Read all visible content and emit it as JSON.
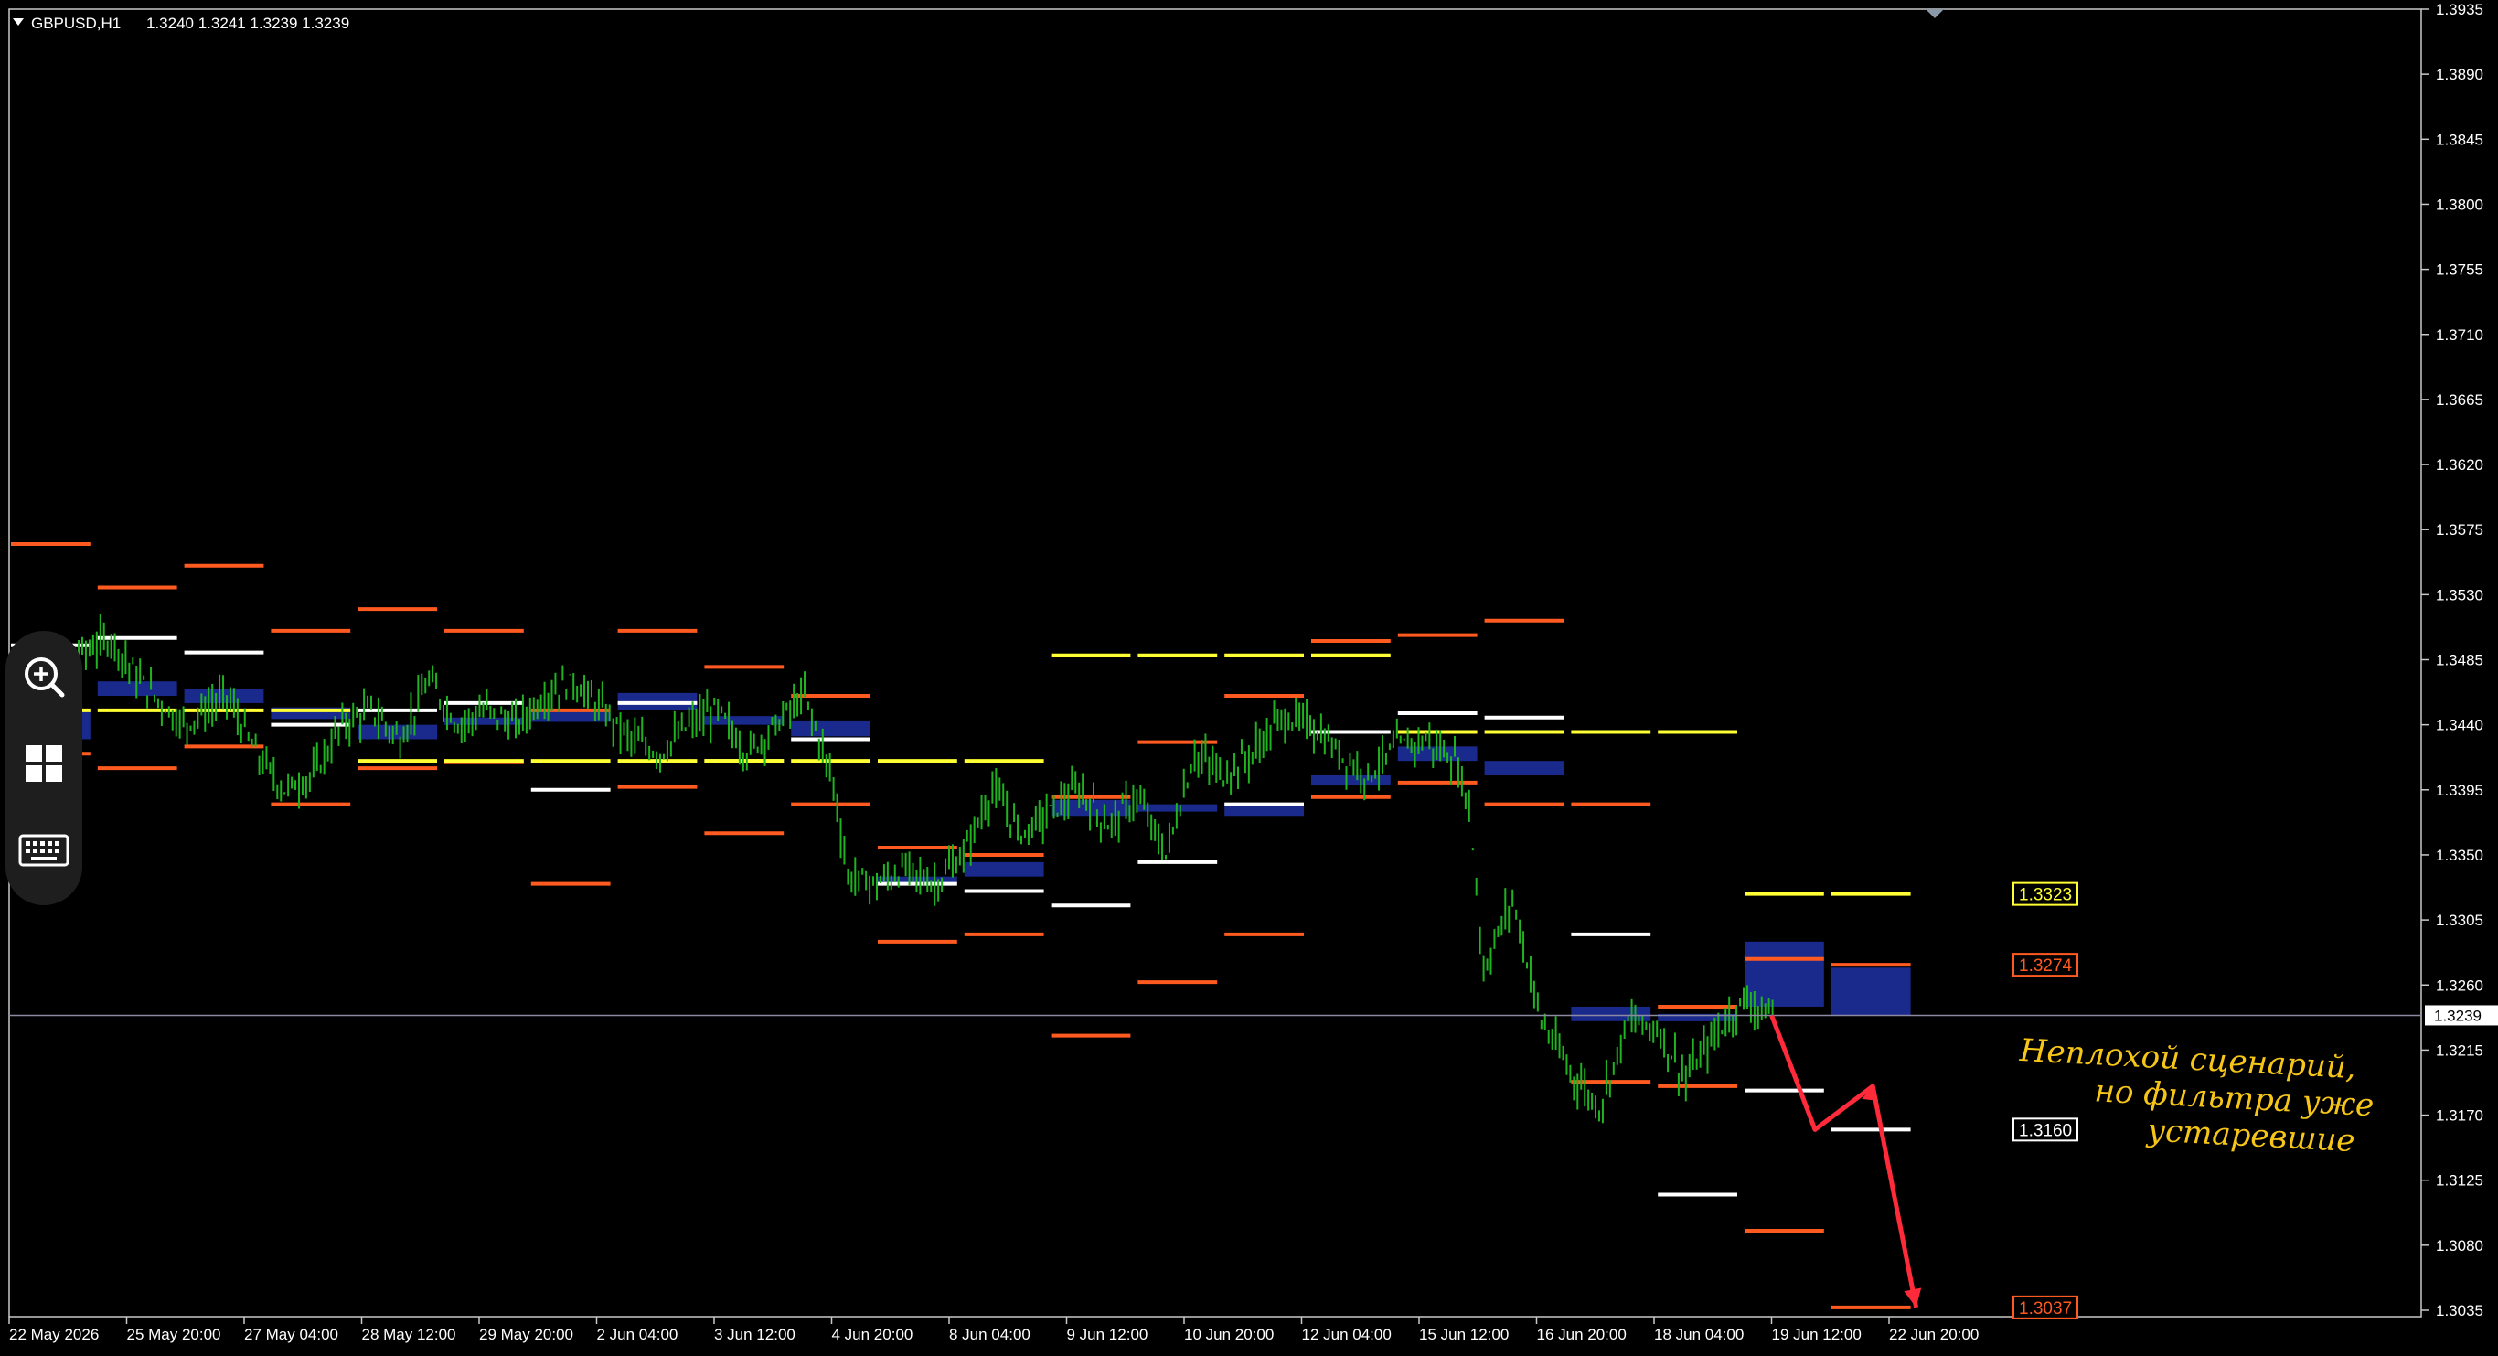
{
  "header": {
    "symbol": "GBPUSD,H1",
    "ohlc": "1.3240 1.3241 1.3239 1.3239"
  },
  "toolbar": {
    "tools": [
      "zoom-in-icon",
      "windows-grid-icon",
      "keyboard-icon"
    ]
  },
  "annotation": {
    "lines": [
      "Неплохой сценарий,",
      "но фильтра уже",
      "устаревшие"
    ],
    "color": "#f5c518"
  },
  "colors": {
    "background": "#000000",
    "grid_frame": "#c8c8c8",
    "candles": "#1fb31f",
    "orange_level": "#ff5a1f",
    "white_level": "#ffffff",
    "yellow_level": "#ffff33",
    "zone": "#1a2a8c",
    "arrow": "#ff2a3a",
    "current_price_line": "#8a8aa0"
  },
  "chart_data": {
    "type": "candlestick",
    "ylim": [
      1.3035,
      1.3935
    ],
    "y_ticks": [
      "1.3935",
      "1.3890",
      "1.3845",
      "1.3800",
      "1.3755",
      "1.3710",
      "1.3665",
      "1.3620",
      "1.3575",
      "1.3530",
      "1.3485",
      "1.3440",
      "1.3395",
      "1.3350",
      "1.3305",
      "1.3260",
      "1.3215",
      "1.3170",
      "1.3125",
      "1.3080",
      "1.3035"
    ],
    "x_ticks": [
      "22 May 2026",
      "25 May 20:00",
      "27 May 04:00",
      "28 May 12:00",
      "29 May 20:00",
      "2 Jun 04:00",
      "3 Jun 12:00",
      "4 Jun 20:00",
      "8 Jun 04:00",
      "9 Jun 12:00",
      "10 Jun 20:00",
      "12 Jun 04:00",
      "15 Jun 12:00",
      "16 Jun 20:00",
      "18 Jun 04:00",
      "19 Jun 12:00",
      "22 Jun 20:00"
    ],
    "close_path": [
      [
        0,
        1.3445
      ],
      [
        3,
        1.348
      ],
      [
        7,
        1.35
      ],
      [
        9,
        1.347
      ],
      [
        12,
        1.344
      ],
      [
        15,
        1.346
      ],
      [
        17,
        1.342
      ],
      [
        19,
        1.3395
      ],
      [
        21,
        1.3405
      ],
      [
        23,
        1.344
      ],
      [
        25,
        1.345
      ],
      [
        27,
        1.343
      ],
      [
        29,
        1.347
      ],
      [
        31,
        1.344
      ],
      [
        33,
        1.345
      ],
      [
        35,
        1.344
      ],
      [
        37,
        1.346
      ],
      [
        39,
        1.347
      ],
      [
        41,
        1.345
      ],
      [
        43,
        1.343
      ],
      [
        45,
        1.342
      ],
      [
        47,
        1.344
      ],
      [
        49,
        1.345
      ],
      [
        51,
        1.342
      ],
      [
        53,
        1.344
      ],
      [
        55,
        1.346
      ],
      [
        57,
        1.34
      ],
      [
        58,
        1.3335
      ],
      [
        60,
        1.333
      ],
      [
        62,
        1.334
      ],
      [
        64,
        1.333
      ],
      [
        66,
        1.335
      ],
      [
        68,
        1.3395
      ],
      [
        70,
        1.3365
      ],
      [
        72,
        1.338
      ],
      [
        74,
        1.3395
      ],
      [
        76,
        1.337
      ],
      [
        78,
        1.339
      ],
      [
        80,
        1.335
      ],
      [
        82,
        1.342
      ],
      [
        84,
        1.3405
      ],
      [
        86,
        1.342
      ],
      [
        88,
        1.3445
      ],
      [
        90,
        1.344
      ],
      [
        92,
        1.342
      ],
      [
        94,
        1.3405
      ],
      [
        96,
        1.3425
      ],
      [
        98,
        1.343
      ],
      [
        100,
        1.3415
      ],
      [
        101,
        1.3385
      ],
      [
        102,
        1.327
      ],
      [
        104,
        1.332
      ],
      [
        106,
        1.3235
      ],
      [
        108,
        1.32
      ],
      [
        110,
        1.3175
      ],
      [
        112,
        1.3235
      ],
      [
        114,
        1.323
      ],
      [
        116,
        1.3195
      ],
      [
        118,
        1.3225
      ],
      [
        120,
        1.325
      ],
      [
        122,
        1.3239
      ]
    ],
    "session_levels": [
      [
        0,
        1.3565,
        1.3495,
        1.342,
        1.345,
        1.343
      ],
      [
        1,
        1.3535,
        1.35,
        1.341,
        1.347,
        1.346
      ],
      [
        2,
        1.355,
        1.349,
        1.3425,
        1.3465,
        1.3455
      ],
      [
        3,
        1.3505,
        1.344,
        1.3385,
        1.3452,
        1.3444
      ],
      [
        4,
        1.352,
        1.345,
        1.341,
        1.344,
        1.343
      ],
      [
        5,
        1.3505,
        1.3455,
        1.3414,
        1.3445,
        1.344
      ],
      [
        6,
        1.345,
        1.3395,
        1.333,
        1.345,
        1.3442
      ],
      [
        7,
        1.3505,
        1.3455,
        1.3397,
        1.3462,
        1.345
      ],
      [
        8,
        1.348,
        1.3415,
        1.3365,
        1.3446,
        1.344
      ],
      [
        9,
        1.346,
        1.343,
        1.3385,
        1.3443,
        1.3432
      ],
      [
        10,
        1.3355,
        1.333,
        1.329,
        1.3335,
        1.333
      ],
      [
        11,
        1.335,
        1.3325,
        1.3295,
        1.3345,
        1.3335
      ],
      [
        12,
        1.339,
        1.3315,
        1.3225,
        1.3388,
        1.3377
      ],
      [
        13,
        1.3428,
        1.3345,
        1.3262,
        1.3385,
        1.338
      ],
      [
        14,
        1.346,
        1.3385,
        1.3295,
        1.3385,
        1.3377
      ],
      [
        15,
        1.3498,
        1.3435,
        1.339,
        1.3405,
        1.3398
      ],
      [
        16,
        1.3502,
        1.3448,
        1.34,
        1.3425,
        1.3415
      ],
      [
        17,
        1.3512,
        1.3445,
        1.3385,
        1.3415,
        1.3405
      ],
      [
        18,
        1.3385,
        1.3295,
        1.3193,
        1.3245,
        1.3235
      ],
      [
        19,
        1.3245,
        1.3115,
        1.319,
        1.324,
        1.3235
      ],
      [
        20,
        1.3278,
        1.3187,
        1.309,
        1.329,
        1.3245
      ],
      [
        21,
        1.3274,
        1.316,
        1.3037,
        1.3272,
        1.3239
      ]
    ],
    "yellow_levels": [
      [
        1.345,
        1.345
      ],
      [
        1.3415,
        1.3415
      ],
      [
        1.3415,
        1.3415
      ],
      [
        1.3488,
        1.3485
      ],
      [
        1.3435,
        1.3435
      ],
      [
        1.3323,
        1.3323
      ]
    ],
    "price_tags": [
      {
        "value": "1.3323",
        "color": "#ffff33"
      },
      {
        "value": "1.3274",
        "color": "#ff5a1f"
      },
      {
        "value": "1.3160",
        "color": "#ffffff"
      },
      {
        "value": "1.3037",
        "color": "#ff5a1f"
      }
    ],
    "current_price": 1.3239,
    "current_price_label": "1.3239",
    "scenario_path": [
      [
        122,
        1.3239
      ],
      [
        125,
        1.316
      ],
      [
        129,
        1.319
      ],
      [
        132,
        1.3037
      ]
    ]
  }
}
